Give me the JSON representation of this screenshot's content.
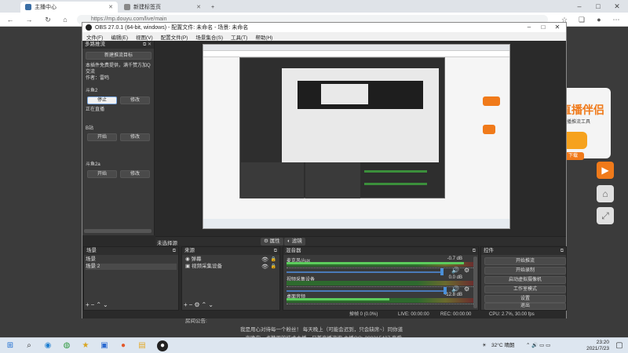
{
  "browser": {
    "tabs": [
      {
        "label": "主播中心"
      },
      {
        "label": "新建标签页"
      }
    ],
    "new_tab": "+",
    "url": "https://mp.douyu.com/live/main"
  },
  "obs": {
    "title": "OBS 27.0.1 (64-bit, windows) - 配置文件: 未命名 - 场景: 未命名",
    "menu": [
      "文件(F)",
      "编辑(E)",
      "视图(V)",
      "配置文件(P)",
      "场景集合(S)",
      "工具(T)",
      "帮助(H)"
    ],
    "multi_stream": {
      "title": "多路推流",
      "new_target": "新建推流目标",
      "plugin_text": "本插件免费提供，满千赞方加Q交流",
      "author": "作者：雷鸣",
      "targets": [
        {
          "name": "斗鱼2",
          "start": "停止",
          "edit": "修改",
          "status": "正在直播"
        },
        {
          "name": "B站",
          "start": "开始",
          "edit": "修改"
        },
        {
          "name": "斗鱼2a",
          "start": "开始",
          "edit": "修改"
        }
      ]
    },
    "source_bar": {
      "label": "未选择源",
      "properties": "属性",
      "filters": "滤镜"
    },
    "scenes": {
      "title": "场景",
      "items": [
        "场景",
        "场景 2"
      ]
    },
    "sources": {
      "title": "来源",
      "items": [
        "弹幕",
        "视频采集设备"
      ]
    },
    "mixer": {
      "title": "混音器",
      "channels": [
        {
          "name": "麦克风/Aux",
          "db": "-0.7 dB",
          "level": 0.95
        },
        {
          "name": "视频采集设备",
          "db": "0.0 dB",
          "level": 0.0
        },
        {
          "name": "桌面音频",
          "db": "-12.8 dB",
          "level": 0.55
        }
      ]
    },
    "controls": {
      "title": "控件",
      "buttons": [
        "开始推流",
        "开始录制",
        "启动虚拟摄像机",
        "工作室模式",
        "设置",
        "退出"
      ]
    },
    "status": {
      "drop": "掉帧 0 (0.0%)",
      "live": "LIVE: 00:00:00",
      "rec": "REC: 00:00:00",
      "cpu": "CPU: 2.7%, 30.00 fps"
    }
  },
  "page": {
    "announce_label": "房间公告:",
    "announce_line1": "我是用心对待每一个粉丝！  每天晚上（可能会迟到，只会缺席~）同你道",
    "announce_line2": "一声晚安，点赞周的技术主播，日首直播咨询 主播QQ: 208315437 直爱",
    "side_brand": "直播伴侣",
    "side_sub": "直播推流工具",
    "side_btn": "下载"
  },
  "taskbar": {
    "weather": "32°C 晴朗",
    "time": "23:20",
    "date": "2021/7/23"
  }
}
